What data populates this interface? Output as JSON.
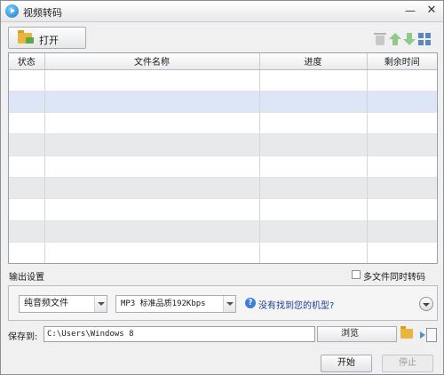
{
  "window": {
    "title": "视频转码",
    "minimize_glyph": "—",
    "close_glyph": "✕"
  },
  "toolbar": {
    "open_label": "打开",
    "icons": [
      "folder-add-icon",
      "trash-icon",
      "move-up-icon",
      "move-down-icon",
      "grid-view-icon"
    ]
  },
  "table": {
    "columns": [
      "状态",
      "文件名称",
      "进度",
      "剩余时间"
    ],
    "rows": [
      {
        "status": "",
        "name": "",
        "progress": "",
        "remaining": ""
      },
      {
        "status": "",
        "name": "",
        "progress": "",
        "remaining": ""
      },
      {
        "status": "",
        "name": "",
        "progress": "",
        "remaining": ""
      },
      {
        "status": "",
        "name": "",
        "progress": "",
        "remaining": ""
      },
      {
        "status": "",
        "name": "",
        "progress": "",
        "remaining": ""
      },
      {
        "status": "",
        "name": "",
        "progress": "",
        "remaining": ""
      },
      {
        "status": "",
        "name": "",
        "progress": "",
        "remaining": ""
      },
      {
        "status": "",
        "name": "",
        "progress": "",
        "remaining": ""
      },
      {
        "status": "",
        "name": "",
        "progress": "",
        "remaining": ""
      }
    ]
  },
  "output": {
    "section_label": "输出设置",
    "multi_file_label": "多文件同时转码",
    "multi_file_checked": false,
    "format_type": "纯音频文件",
    "quality": "MP3 标准品质192Kbps",
    "help_link": "没有找到您的机型?"
  },
  "save": {
    "label": "保存到:",
    "path": "C:\\Users\\Windows 8",
    "browse_label": "浏览"
  },
  "actions": {
    "start_label": "开始",
    "stop_label": "停止"
  },
  "colors": {
    "selected_row": "#dde6f6",
    "alt_row": "#e8e9ea",
    "link": "#1b3f8f"
  }
}
